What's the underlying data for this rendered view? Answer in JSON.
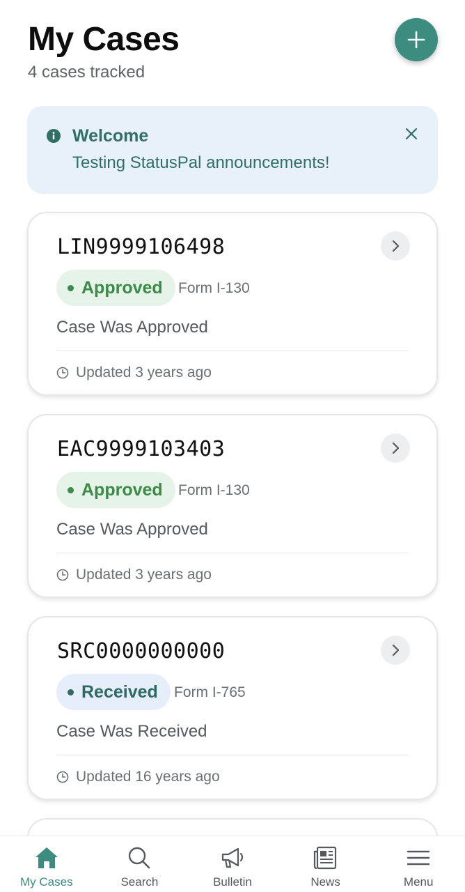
{
  "header": {
    "title": "My Cases",
    "subtitle": "4 cases tracked",
    "add_icon": "plus-icon"
  },
  "banner": {
    "title": "Welcome",
    "text": "Testing StatusPal announcements!",
    "icon": "info-icon",
    "close_icon": "close-icon"
  },
  "cases": [
    {
      "number": "LIN9999106498",
      "status": "Approved",
      "form": "Form I-130",
      "status_text": "Case Was Approved",
      "updated": "Updated 3 years ago"
    },
    {
      "number": "EAC9999103403",
      "status": "Approved",
      "form": "Form I-130",
      "status_text": "Case Was Approved",
      "updated": "Updated 3 years ago"
    },
    {
      "number": "SRC0000000000",
      "status": "Received",
      "form": "Form I-765",
      "status_text": "Case Was Received",
      "updated": "Updated 16 years ago"
    }
  ],
  "tabs": [
    {
      "label": "My Cases",
      "icon": "home-icon",
      "active": true
    },
    {
      "label": "Search",
      "icon": "search-icon"
    },
    {
      "label": "Bulletin",
      "icon": "megaphone-icon"
    },
    {
      "label": "News",
      "icon": "newspaper-icon"
    },
    {
      "label": "Menu",
      "icon": "menu-icon"
    }
  ],
  "colors": {
    "accent": "#3d8c80",
    "approved": "#3b8a47",
    "received": "#2d6a61",
    "banner_bg": "#e8f0fa"
  }
}
